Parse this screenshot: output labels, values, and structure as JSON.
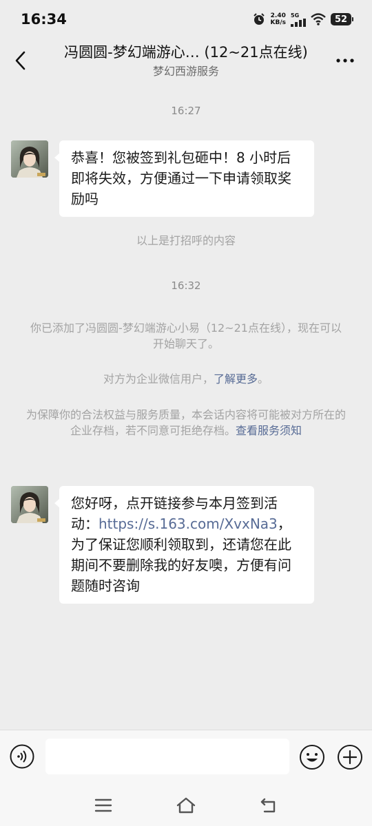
{
  "status_bar": {
    "time": "16:34",
    "net_speed_value": "2.40",
    "net_speed_unit": "KB/s",
    "network_type": "5G",
    "battery": "52"
  },
  "header": {
    "title": "冯圆圆-梦幻端游心… (12~21点在线)",
    "subtitle": "梦幻西游服务"
  },
  "chat": {
    "timestamp_1": "16:27",
    "message_1": "恭喜！您被签到礼包砸中！8 小时后即将失效，方便通过一下申请领取奖励吗",
    "greeting_note": "以上是打招呼的内容",
    "timestamp_2": "16:32",
    "added_note": "你已添加了冯圆圆-梦幻端游心小易（12~21点在线），现在可以开始聊天了。",
    "enterprise_note": "对方为企业微信用户，",
    "enterprise_link": "了解更多",
    "enterprise_end": "。",
    "archive_note": "为保障你的合法权益与服务质量，本会话内容将可能被对方所在的企业存档，若不同意可拒绝存档。",
    "archive_link": "查看服务须知",
    "message_2_part1": "您好呀，点开链接参与本月签到活动：",
    "message_2_link": "https://s.163.com/XvxNa3",
    "message_2_part2": "，为了保证您顺利领取到，还请您在此期间不要删除我的好友噢，方便有问题随时咨询"
  },
  "input": {
    "value": "",
    "placeholder": ""
  },
  "icons": {
    "back": "back-chevron-icon",
    "more": "more-dots-icon",
    "voice": "voice-icon",
    "emoji": "emoji-icon",
    "plus": "plus-icon",
    "nav_menu": "menu-icon",
    "nav_home": "home-icon",
    "nav_back": "back-icon"
  },
  "colors": {
    "background": "#ededed",
    "bubble": "#ffffff",
    "link": "#576b95",
    "system_text": "#a3a3a3"
  }
}
